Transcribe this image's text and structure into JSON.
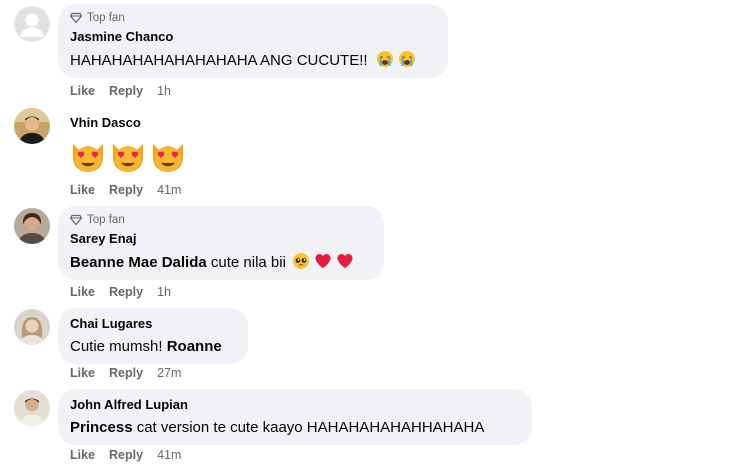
{
  "badge_label": "Top fan",
  "actions": {
    "like": "Like",
    "reply": "Reply"
  },
  "comments": [
    {
      "name": "Jasmine Chanco",
      "top_fan": true,
      "text": "HAHAHAHAHAHAHAHAHA ANG CUCUTE!!",
      "emoji": [
        "loudly-crying-face",
        "loudly-crying-face"
      ],
      "time": "1h"
    },
    {
      "name": "Vhin Dasco",
      "top_fan": false,
      "text": "",
      "emoji": [
        "heart-eyes-cat",
        "heart-eyes-cat",
        "heart-eyes-cat"
      ],
      "time": "41m"
    },
    {
      "name": "Sarey Enaj",
      "top_fan": true,
      "mention": "Beanne Mae Dalida",
      "text": " cute nila bii",
      "emoji": [
        "pleading-face",
        "red-heart",
        "red-heart"
      ],
      "time": "1h"
    },
    {
      "name": "Chai Lugares",
      "top_fan": false,
      "text": "Cutie mumsh! ",
      "mention_after": "Roanne",
      "time": "27m"
    },
    {
      "name": "John Alfred Lupian",
      "top_fan": false,
      "mention": "Princess",
      "text": " cat version te cute kaayo HAHAHAHAHAHHAHAHA",
      "time": "41m"
    }
  ],
  "colors": {
    "bubble": "#f0f2f5",
    "meta": "#65676b",
    "text": "#050505",
    "heart": "#e41e3f"
  }
}
